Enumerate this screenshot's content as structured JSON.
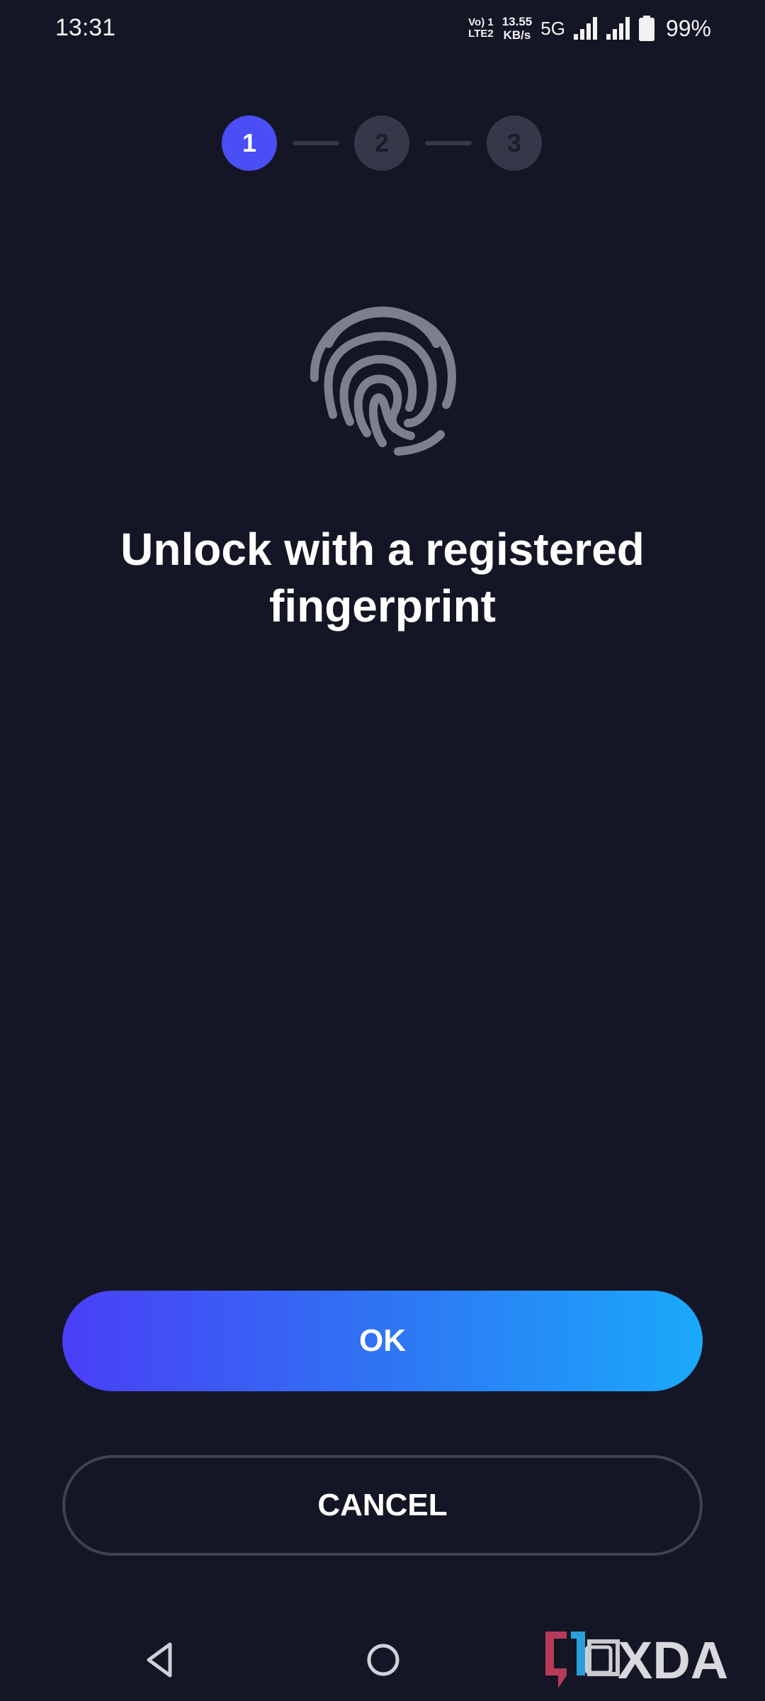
{
  "status_bar": {
    "time": "13:31",
    "volte_top": "Vo) 1",
    "volte_bottom": "LTE2",
    "speed_value": "13.55",
    "speed_unit": "KB/s",
    "network": "5G",
    "battery": "99%"
  },
  "stepper": {
    "steps": [
      "1",
      "2",
      "3"
    ],
    "active_step": 1,
    "active_color": "#4a4ef5",
    "inactive_color": "#353848"
  },
  "prompt": {
    "icon": "fingerprint-icon",
    "title_line1": "Unlock with a registered",
    "title_line2": "fingerprint"
  },
  "actions": {
    "ok_label": "OK",
    "cancel_label": "CANCEL"
  },
  "nav": {
    "back_icon": "back-triangle-icon",
    "home_icon": "home-circle-icon",
    "recents_icon": "recents-square-icon"
  },
  "watermark": {
    "text": "XDA"
  },
  "colors": {
    "background": "#141625",
    "ok_gradient_start": "#4a3ff7",
    "ok_gradient_end": "#1aa9fb",
    "cancel_border": "#3f4252"
  }
}
